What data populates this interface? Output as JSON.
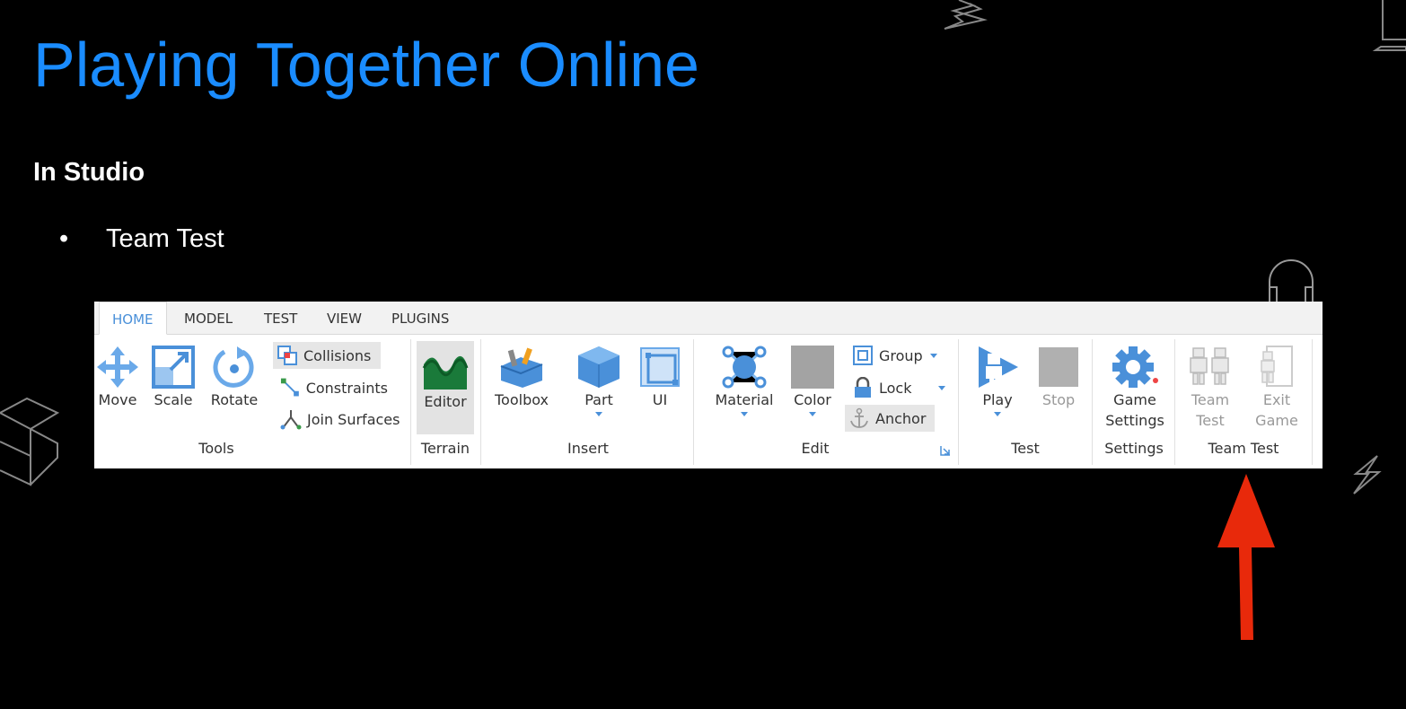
{
  "slide": {
    "title": "Playing Together Online",
    "subtitle": "In Studio",
    "bullet_symbol": "•",
    "bullet": "Team Test"
  },
  "ribbon": {
    "tabs": [
      "HOME",
      "MODEL",
      "TEST",
      "VIEW",
      "PLUGINS"
    ],
    "active_tab": "HOME",
    "groups": {
      "tools": {
        "label": "Tools",
        "move": "Move",
        "scale": "Scale",
        "rotate": "Rotate",
        "collisions": "Collisions",
        "constraints": "Constraints",
        "join_surfaces": "Join Surfaces"
      },
      "terrain": {
        "label": "Terrain",
        "editor": "Editor"
      },
      "insert": {
        "label": "Insert",
        "toolbox": "Toolbox",
        "part": "Part",
        "ui": "UI"
      },
      "edit": {
        "label": "Edit",
        "material": "Material",
        "color": "Color",
        "group": "Group",
        "lock": "Lock",
        "anchor": "Anchor"
      },
      "test": {
        "label": "Test",
        "play": "Play",
        "stop": "Stop"
      },
      "settings": {
        "label": "Settings",
        "game_line1": "Game",
        "game_line2": "Settings"
      },
      "team_test": {
        "label": "Team Test",
        "team_line1": "Team",
        "team_line2": "Test",
        "exit_line1": "Exit",
        "exit_line2": "Game"
      }
    }
  },
  "colors": {
    "title": "#1a8cff",
    "accent_blue": "#4a90d9",
    "arrow_red": "#e8290b",
    "terrain_green": "#1a7a3a"
  }
}
